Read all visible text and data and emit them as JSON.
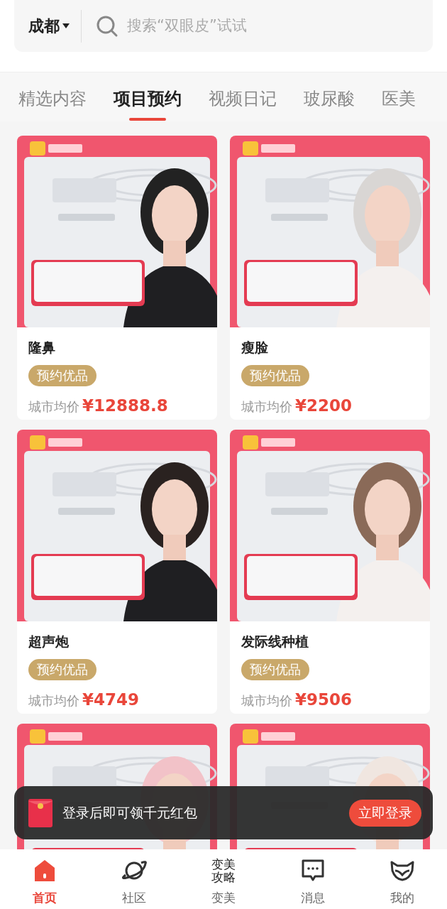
{
  "search": {
    "city": "成都",
    "placeholder": "搜索“双眼皮”试试"
  },
  "tabs": [
    {
      "label": "精选内容",
      "selected": false
    },
    {
      "label": "项目预约",
      "selected": true
    },
    {
      "label": "视频日记",
      "selected": false
    },
    {
      "label": "玻尿酸",
      "selected": false
    },
    {
      "label": "医美",
      "selected": false
    }
  ],
  "cards": [
    {
      "title": "隆鼻",
      "tag": "预约优品",
      "price_label": "城市均价",
      "currency": "¥",
      "price": "12888.8"
    },
    {
      "title": "瘦脸",
      "tag": "预约优品",
      "price_label": "城市均价",
      "currency": "¥",
      "price": "2200"
    },
    {
      "title": "超声炮",
      "tag": "预约优品",
      "price_label": "城市均价",
      "currency": "¥",
      "price": "4749"
    },
    {
      "title": "发际线种植",
      "tag": "预约优品",
      "price_label": "城市均价",
      "currency": "¥",
      "price": "9506"
    }
  ],
  "toast": {
    "message": "登录后即可领千元红包",
    "button": "立即登录"
  },
  "nav": [
    {
      "label": "首页",
      "kind": "home",
      "selected": true
    },
    {
      "label": "社区",
      "kind": "planet",
      "selected": false
    },
    {
      "label": "变美",
      "kind": "logo",
      "logo_text": "变美攻略",
      "selected": false
    },
    {
      "label": "消息",
      "kind": "message",
      "selected": false
    },
    {
      "label": "我的",
      "kind": "fox",
      "selected": false
    }
  ]
}
